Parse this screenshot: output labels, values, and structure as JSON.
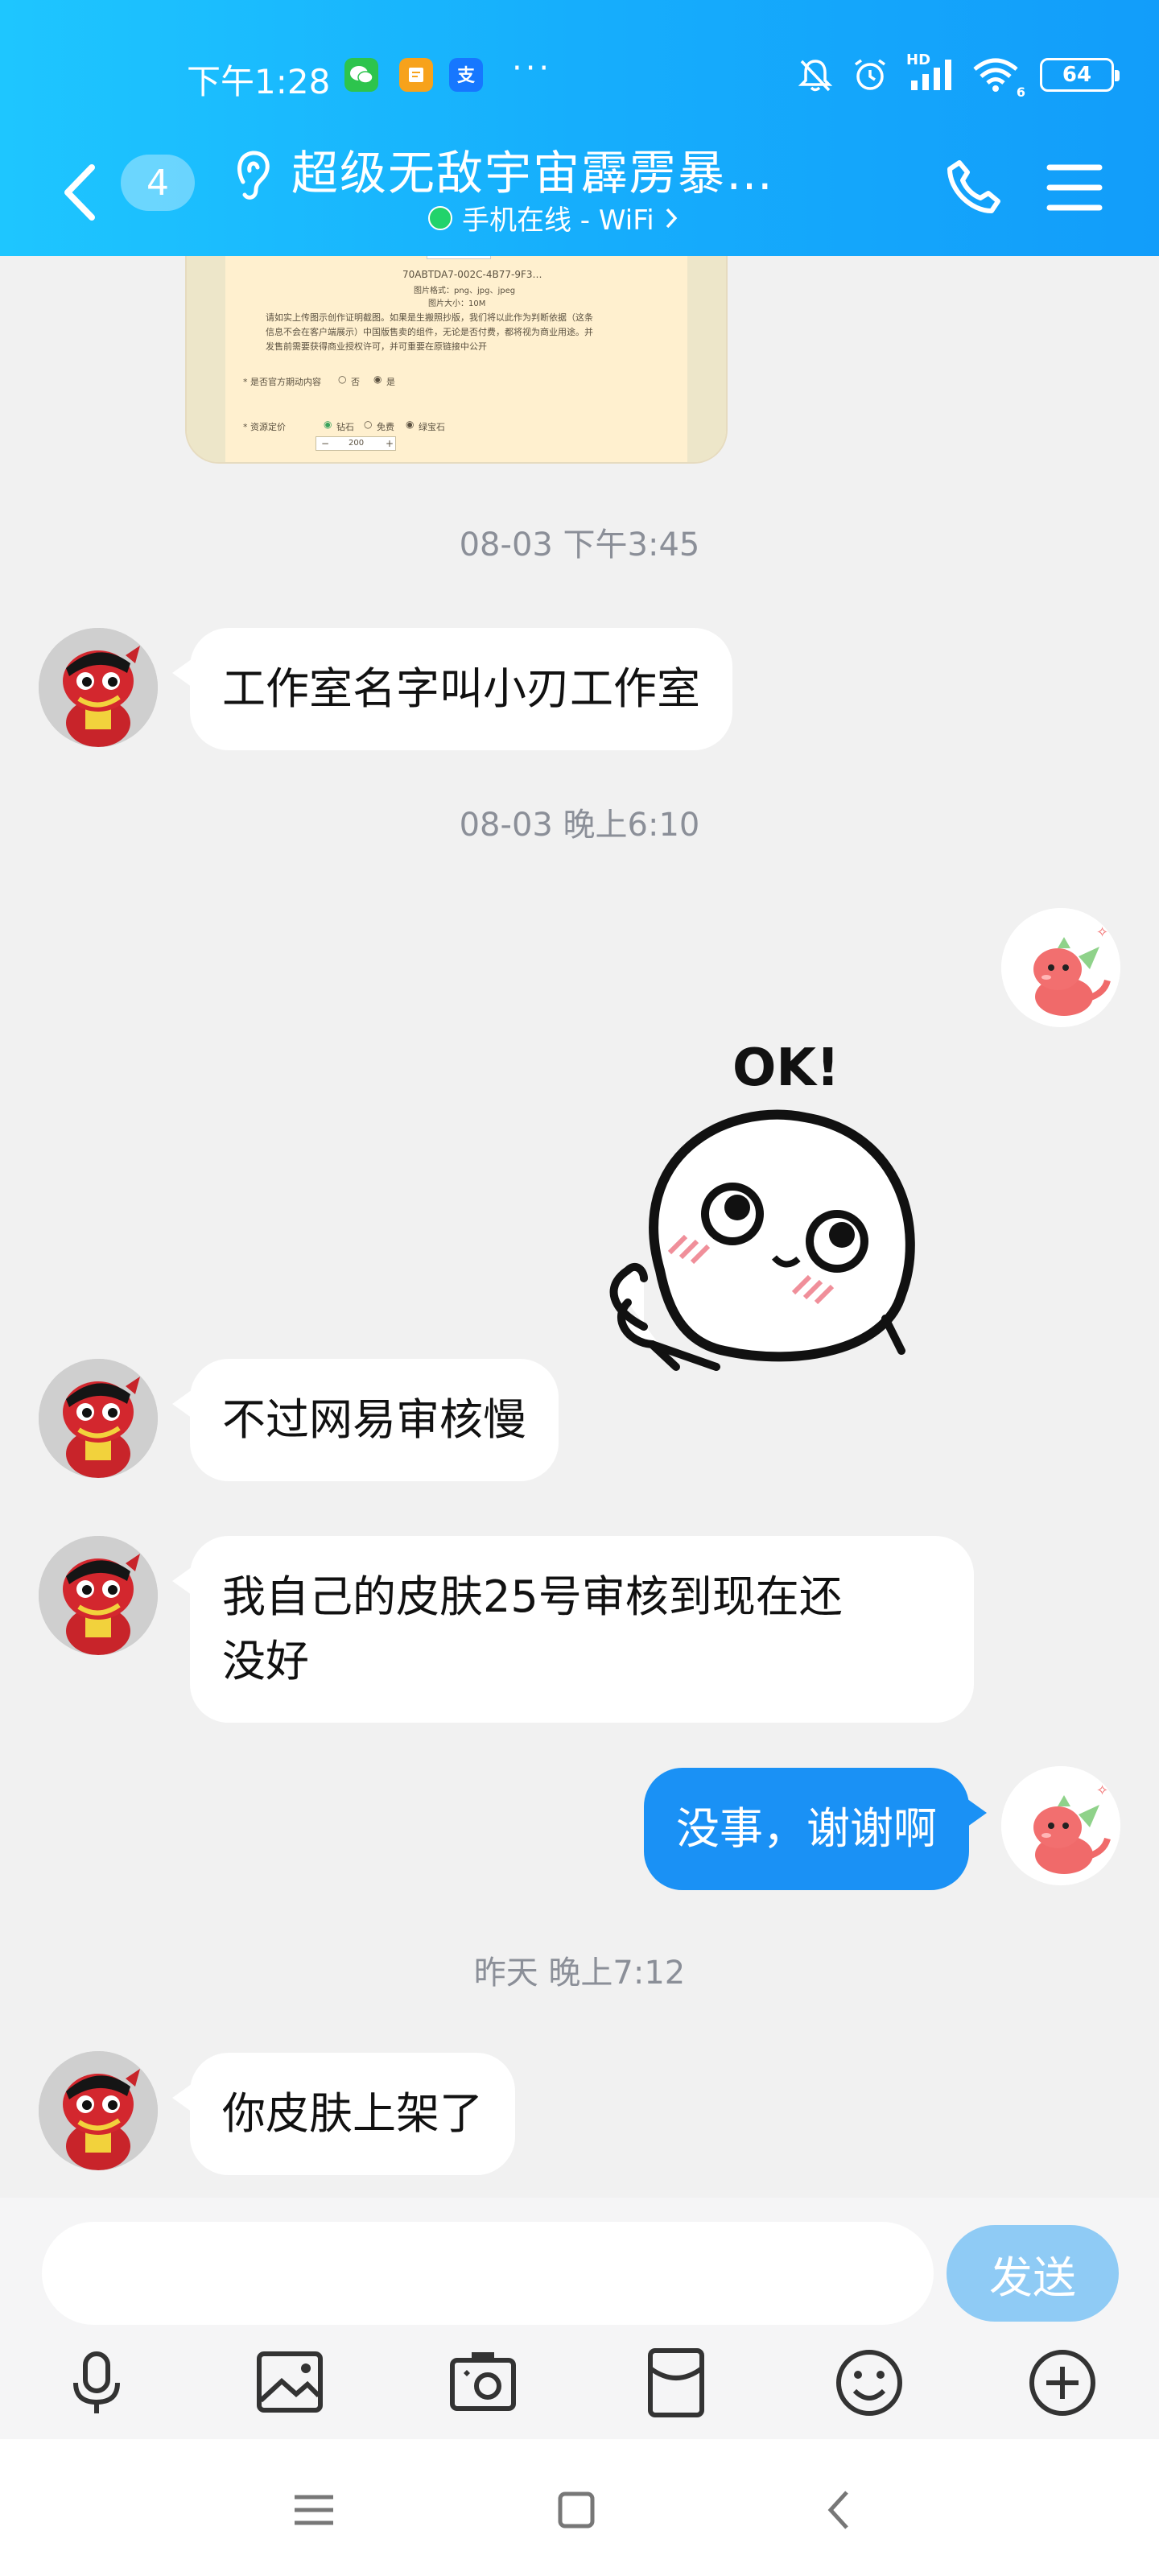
{
  "status_bar": {
    "time": "下午1:28",
    "signal_label": "HD",
    "battery": "64",
    "wifi_level": "6"
  },
  "header": {
    "unread_count": "4",
    "title": "超级无敌宇宙霹雳暴…",
    "subtitle": "手机在线 - WiFi",
    "accent": "#16aefc"
  },
  "shared_image": {
    "filename": "70ABTDA7-002C-4B77-9F3…",
    "format_line": "图片格式：png、jpg、jpeg",
    "size_line": "图片大小：10M",
    "notice_line1": "请如实上传图示创作证明截图。如果是生搬照抄版，我们将以此作为判断依据（这条",
    "notice_line2": "信息不会在客户端展示）中国版售卖的组件，无论是否付费，都将视为商业用途。并",
    "notice_line3": "发售前需要获得商业授权许可，并可重要在原链接中公开",
    "q1_label": "* 是否官方期动内容",
    "q1_opt_yes": "否",
    "q1_opt_no": "是",
    "q2_label": "* 资源定价",
    "q2_opt1": "钻石",
    "q2_opt2": "免费",
    "q2_opt3": "绿宝石",
    "q2_value": "200"
  },
  "messages": [
    {
      "type": "time",
      "text": "08-03 下午3:45"
    },
    {
      "type": "left",
      "text": "工作室名字叫小刃工作室"
    },
    {
      "type": "time",
      "text": "08-03 晚上6:10"
    },
    {
      "type": "sticker",
      "text": "OK!"
    },
    {
      "type": "left",
      "text": "不过网易审核慢"
    },
    {
      "type": "left",
      "line1": "我自己的皮肤25号审核到现在还",
      "line2": "没好"
    },
    {
      "type": "right",
      "text": "没事，谢谢啊"
    },
    {
      "type": "time",
      "text": "昨天 晚上7:12"
    },
    {
      "type": "left",
      "text": "你皮肤上架了"
    }
  ],
  "input": {
    "placeholder": "",
    "send_label": "发送"
  },
  "icons": {
    "toolbar": [
      "microphone-icon",
      "image-icon",
      "camera-icon",
      "red-packet-icon",
      "emoji-icon",
      "plus-icon"
    ],
    "system_nav": [
      "menu-icon",
      "home-icon",
      "back-icon"
    ]
  },
  "colors": {
    "bubble_right": "#1a91f5",
    "send_button": "#8fcbf5",
    "online": "#22d36b"
  }
}
